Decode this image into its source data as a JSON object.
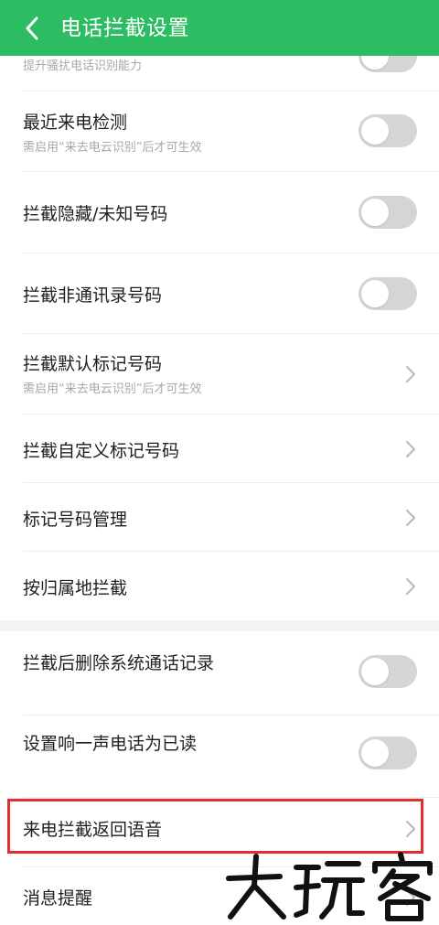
{
  "header": {
    "title": "电话拦截设置",
    "background": "#2cbd62"
  },
  "rows": [
    {
      "title": "提升骚扰电话识别能力",
      "control": "toggle",
      "on": false
    },
    {
      "title": "最近来电检测",
      "subtitle": "需启用“来去电云识别”后才可生效",
      "control": "toggle",
      "on": false
    },
    {
      "title": "拦截隐藏/未知号码",
      "control": "toggle",
      "on": false
    },
    {
      "title": "拦截非通讯录号码",
      "control": "toggle",
      "on": false
    },
    {
      "title": "拦截默认标记号码",
      "subtitle": "需启用“来去电云识别”后才可生效",
      "control": "chevron"
    },
    {
      "title": "拦截自定义标记号码",
      "control": "chevron"
    },
    {
      "title": "标记号码管理",
      "control": "chevron"
    },
    {
      "title": "按归属地拦截",
      "control": "chevron"
    },
    {
      "title": "拦截后删除系统通话记录",
      "control": "toggle",
      "on": false
    },
    {
      "title": "设置响一声电话为已读",
      "control": "toggle",
      "on": false
    },
    {
      "title": "来电拦截返回语音",
      "control": "chevron",
      "highlighted": true
    },
    {
      "title": "消息提醒",
      "control": "chevron"
    }
  ],
  "watermark": "大玩客",
  "colors": {
    "accent": "#2cbd62",
    "highlight_border": "#e32c2c",
    "toggle_off": "#d5d5d5"
  }
}
